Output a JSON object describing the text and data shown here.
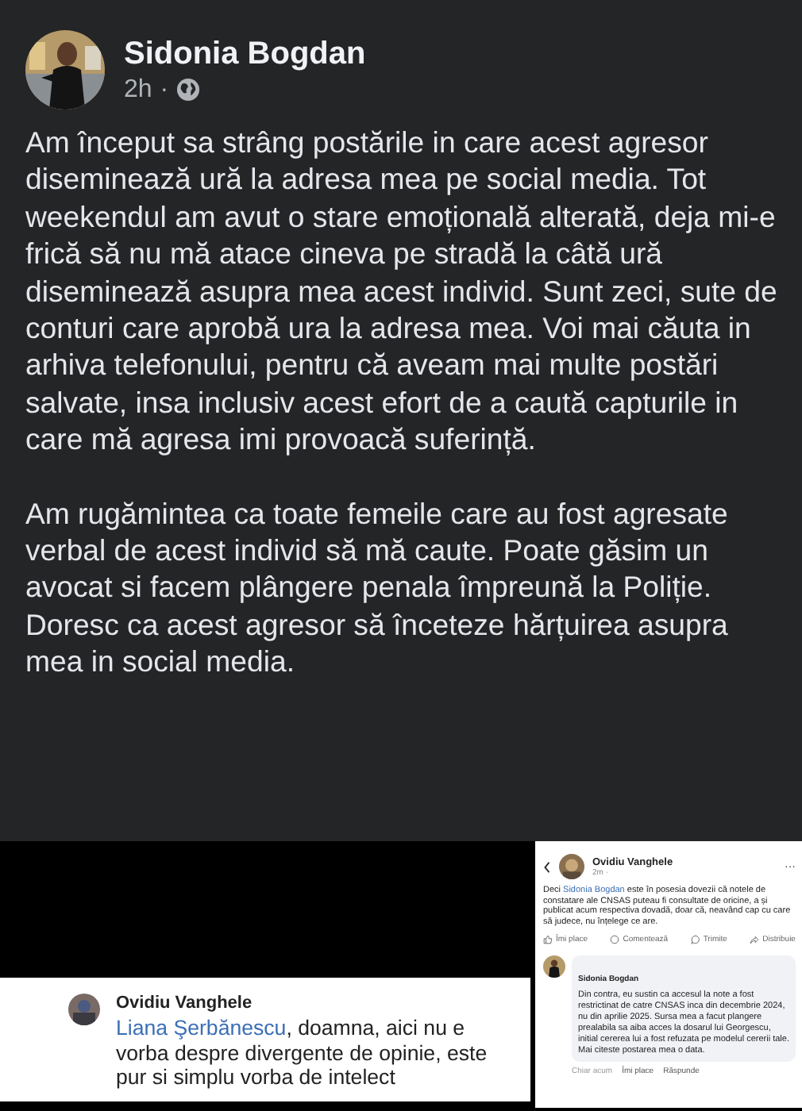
{
  "post": {
    "author": "Sidonia Bogdan",
    "time": "2h",
    "separator": "·",
    "paragraphs": [
      "Am început sa strâng postările in care acest agresor diseminează ură la adresa mea pe social media. Tot weekendul am avut o stare emoțională alterată, deja mi-e frică să nu mă atace cineva pe stradă la câtă ură diseminează asupra mea acest individ. Sunt zeci, sute de conturi care aprobă ura la adresa mea. Voi mai căuta in arhiva telefonului, pentru că aveam mai multe postări salvate, insa inclusiv acest efort de a caută capturile in care mă agresa imi provoacă suferință.",
      "Am rugămintea ca toate femeile care au fost agresate verbal de acest individ să mă caute. Poate găsim un avocat si facem plângere penala împreună la Poliție. Doresc ca acest agresor să înceteze hărțuirea asupra mea in social media."
    ]
  },
  "attachments": [
    {
      "kind": "comment",
      "author": "Ovidiu Vanghele",
      "mention": "Liana Şerbănescu",
      "text": ", doamna, aici nu e vorba despre divergente de opinie, este pur si simplu vorba de intelect"
    },
    {
      "kind": "post",
      "author": "Ovidiu Vanghele",
      "time": "2m",
      "separator": "·",
      "more": "···",
      "text_before": "Deci ",
      "mention": "Sidonia Bogdan",
      "text_after": " este în posesia dovezii că notele de constatare ale CNSAS puteau fi consultate de oricine, a și publicat acum respectiva dovadă, doar că, neavând cap cu care să judece, nu înțelege ce are.",
      "actions": [
        {
          "kind": "like",
          "label": "Îmi place"
        },
        {
          "kind": "comment",
          "label": "Comentează"
        },
        {
          "kind": "send",
          "label": "Trimite"
        },
        {
          "kind": "share",
          "label": "Distribuie"
        }
      ],
      "reply": {
        "author": "Sidonia Bogdan",
        "text": "Din contra, eu sustin ca accesul la note a fost restrictinat de catre CNSAS inca din decembrie 2024, nu din aprilie 2025. Sursa mea a facut plangere prealabila sa aiba acces la dosarul lui Georgescu, initial cererea lui a fost refuzata pe modelul cererii tale. Mai citeste postarea mea o data.",
        "links": [
          "Chiar acum",
          "Îmi place",
          "Răspunde"
        ]
      }
    }
  ]
}
